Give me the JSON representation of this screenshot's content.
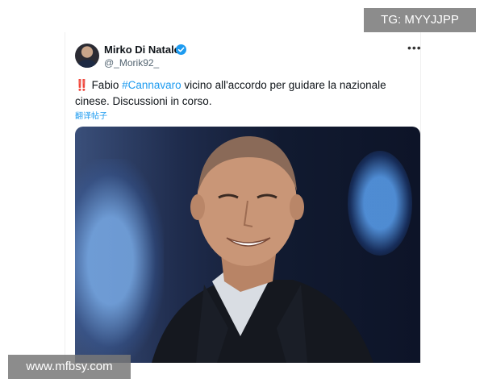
{
  "tweet": {
    "author": {
      "display_name": "Mirko Di Natale",
      "handle": "@_Morik92_",
      "verified": true
    },
    "more_icon": "more-horizontal-icon",
    "text": {
      "alert_glyph": "‼️",
      "prefix": " Fabio ",
      "hashtag": "#Cannavaro",
      "suffix": " vicino all'accordo per guidare la nazionale cinese. Discussioni in corso."
    },
    "translate_label": "翻译帖子",
    "media": {
      "kind": "photo"
    }
  },
  "watermarks": {
    "top_right": "TG: MYYJJPP",
    "bottom_left": "www.mfbsy.com"
  },
  "colors": {
    "link": "#1d9bf0",
    "text": "#0f1419",
    "muted": "#536471",
    "alert": "#e0245e",
    "watermark_bg": "#787878"
  }
}
